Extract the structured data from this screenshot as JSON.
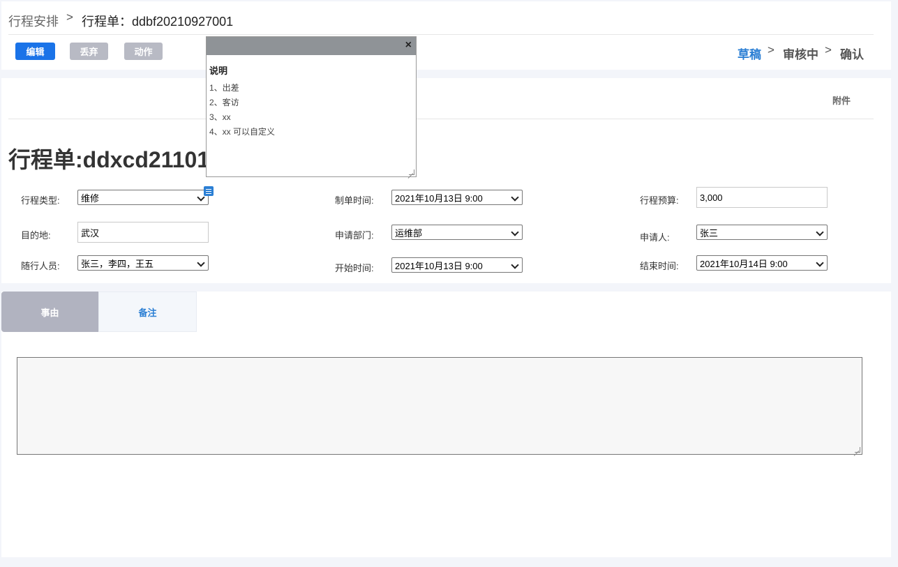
{
  "breadcrumb": {
    "root": "行程安排",
    "separator": ">",
    "current": "行程单：ddbf20210927001"
  },
  "toolbar": {
    "edit_label": "编辑",
    "discard_label": "丢弃",
    "action_label": "动作"
  },
  "status_steps": {
    "draft": "草稿",
    "review": "审核中",
    "confirm": "确认",
    "separator": ">"
  },
  "attachments_label": "附件",
  "doc_title": "行程单:ddxcd21101",
  "form": {
    "trip_type_label": "行程类型:",
    "trip_type_value": "维修",
    "created_time_label": "制单时间:",
    "created_time_value": "2021年10月13日 9:00",
    "budget_label": "行程预算:",
    "budget_value": "3,000",
    "destination_label": "目的地:",
    "destination_value": "武汉",
    "department_label": "申请部门:",
    "department_value": "运维部",
    "applicant_label": "申请人:",
    "applicant_value": "张三",
    "companions_label": "随行人员:",
    "companions_value": "张三，李四，王五",
    "start_time_label": "开始时间:",
    "start_time_value": "2021年10月13日 9:00",
    "end_time_label": "结束时间:",
    "end_time_value": "2021年10月14日 9:00"
  },
  "tabs": {
    "reason": "事由",
    "remarks": "备注"
  },
  "popup": {
    "close": "×",
    "title": "说明",
    "lines": [
      "1、出差",
      "2、客访",
      "3、xx",
      "4、xx  可以自定义"
    ]
  },
  "colors": {
    "primary": "#1a73e8",
    "accent": "#2b7fd4",
    "muted_button": "#b8bac4"
  }
}
